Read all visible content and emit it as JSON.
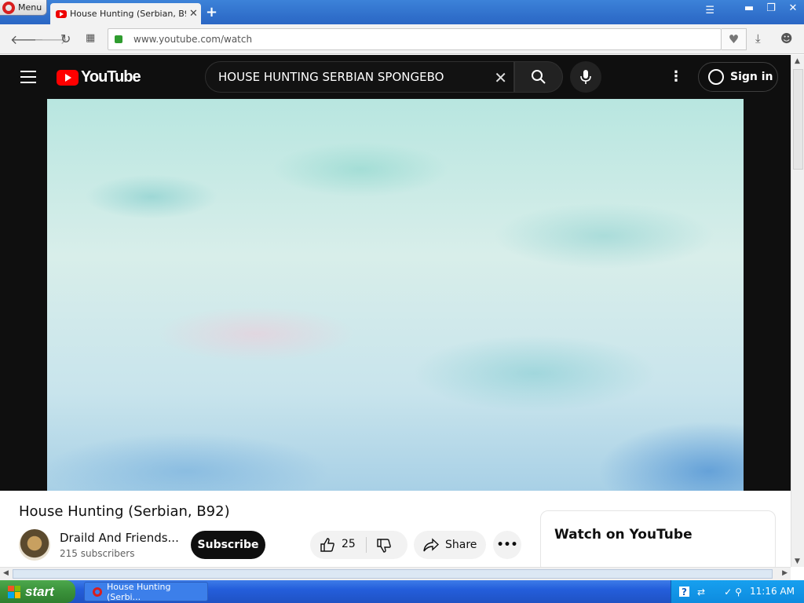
{
  "browser": {
    "menu_label": "Menu",
    "tab_title": "House Hunting (Serbian, B92)",
    "new_tab": "+",
    "tab_close": "✕",
    "url": "www.youtube.com/watch"
  },
  "youtube": {
    "logo_text": "YouTube",
    "search_query": "HOUSE HUNTING SERBIAN SPONGEBO",
    "sign_in": "Sign in",
    "video_title": "House Hunting (Serbian, B92)",
    "channel_name": "Draild And Friends...",
    "subscribers": "215 subscribers",
    "subscribe": "Subscribe",
    "likes": "25",
    "share": "Share",
    "watch_on_youtube": "Watch on YouTube",
    "more_actions": "•••"
  },
  "taskbar": {
    "start": "start",
    "task_title": "House Hunting (Serbi...",
    "clock": "11:16 AM"
  },
  "colors": {
    "yt_red": "#ff0000",
    "taskbar_blue": "#245edb",
    "start_green": "#3a913a"
  }
}
